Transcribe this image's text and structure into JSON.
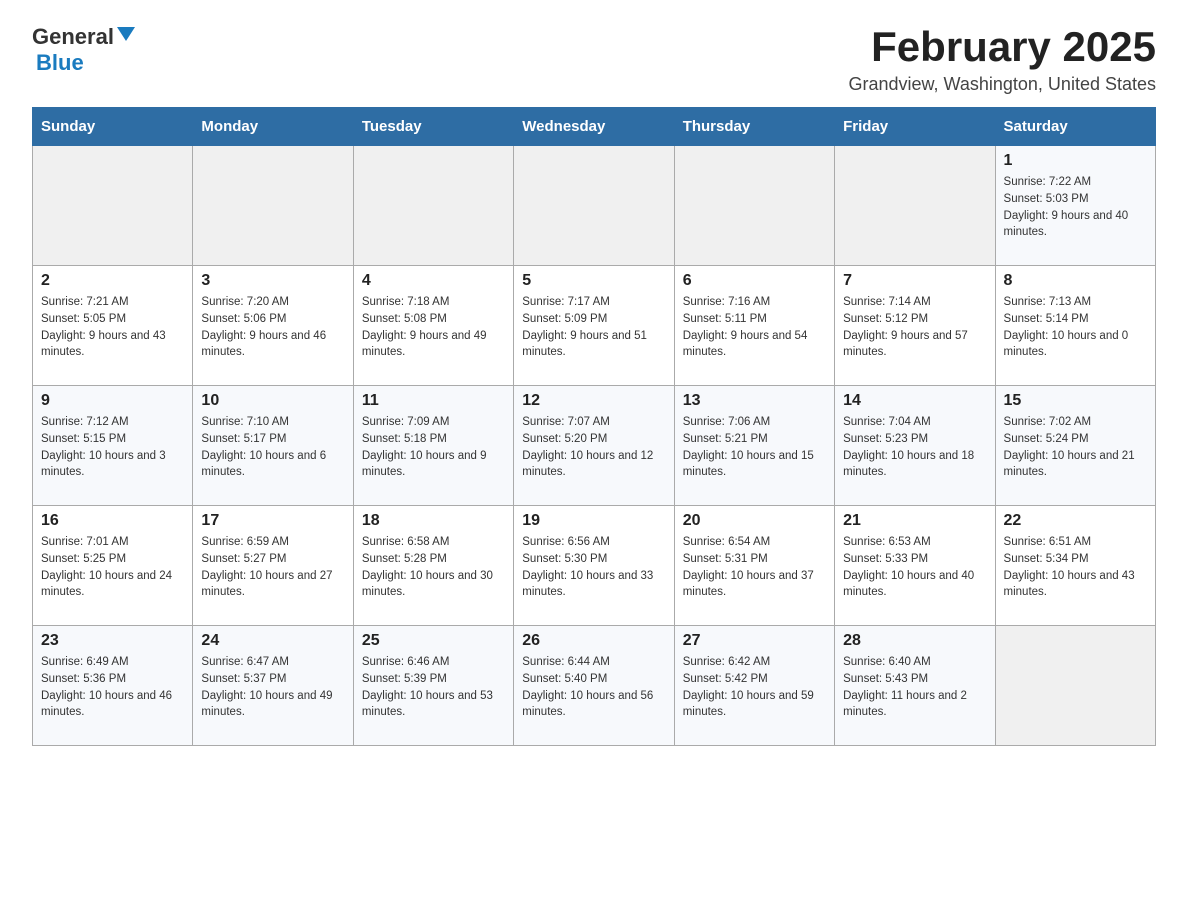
{
  "header": {
    "logo_general": "General",
    "logo_blue": "Blue",
    "month_title": "February 2025",
    "location": "Grandview, Washington, United States"
  },
  "weekdays": [
    "Sunday",
    "Monday",
    "Tuesday",
    "Wednesday",
    "Thursday",
    "Friday",
    "Saturday"
  ],
  "weeks": [
    [
      {
        "day": "",
        "info": ""
      },
      {
        "day": "",
        "info": ""
      },
      {
        "day": "",
        "info": ""
      },
      {
        "day": "",
        "info": ""
      },
      {
        "day": "",
        "info": ""
      },
      {
        "day": "",
        "info": ""
      },
      {
        "day": "1",
        "info": "Sunrise: 7:22 AM\nSunset: 5:03 PM\nDaylight: 9 hours and 40 minutes."
      }
    ],
    [
      {
        "day": "2",
        "info": "Sunrise: 7:21 AM\nSunset: 5:05 PM\nDaylight: 9 hours and 43 minutes."
      },
      {
        "day": "3",
        "info": "Sunrise: 7:20 AM\nSunset: 5:06 PM\nDaylight: 9 hours and 46 minutes."
      },
      {
        "day": "4",
        "info": "Sunrise: 7:18 AM\nSunset: 5:08 PM\nDaylight: 9 hours and 49 minutes."
      },
      {
        "day": "5",
        "info": "Sunrise: 7:17 AM\nSunset: 5:09 PM\nDaylight: 9 hours and 51 minutes."
      },
      {
        "day": "6",
        "info": "Sunrise: 7:16 AM\nSunset: 5:11 PM\nDaylight: 9 hours and 54 minutes."
      },
      {
        "day": "7",
        "info": "Sunrise: 7:14 AM\nSunset: 5:12 PM\nDaylight: 9 hours and 57 minutes."
      },
      {
        "day": "8",
        "info": "Sunrise: 7:13 AM\nSunset: 5:14 PM\nDaylight: 10 hours and 0 minutes."
      }
    ],
    [
      {
        "day": "9",
        "info": "Sunrise: 7:12 AM\nSunset: 5:15 PM\nDaylight: 10 hours and 3 minutes."
      },
      {
        "day": "10",
        "info": "Sunrise: 7:10 AM\nSunset: 5:17 PM\nDaylight: 10 hours and 6 minutes."
      },
      {
        "day": "11",
        "info": "Sunrise: 7:09 AM\nSunset: 5:18 PM\nDaylight: 10 hours and 9 minutes."
      },
      {
        "day": "12",
        "info": "Sunrise: 7:07 AM\nSunset: 5:20 PM\nDaylight: 10 hours and 12 minutes."
      },
      {
        "day": "13",
        "info": "Sunrise: 7:06 AM\nSunset: 5:21 PM\nDaylight: 10 hours and 15 minutes."
      },
      {
        "day": "14",
        "info": "Sunrise: 7:04 AM\nSunset: 5:23 PM\nDaylight: 10 hours and 18 minutes."
      },
      {
        "day": "15",
        "info": "Sunrise: 7:02 AM\nSunset: 5:24 PM\nDaylight: 10 hours and 21 minutes."
      }
    ],
    [
      {
        "day": "16",
        "info": "Sunrise: 7:01 AM\nSunset: 5:25 PM\nDaylight: 10 hours and 24 minutes."
      },
      {
        "day": "17",
        "info": "Sunrise: 6:59 AM\nSunset: 5:27 PM\nDaylight: 10 hours and 27 minutes."
      },
      {
        "day": "18",
        "info": "Sunrise: 6:58 AM\nSunset: 5:28 PM\nDaylight: 10 hours and 30 minutes."
      },
      {
        "day": "19",
        "info": "Sunrise: 6:56 AM\nSunset: 5:30 PM\nDaylight: 10 hours and 33 minutes."
      },
      {
        "day": "20",
        "info": "Sunrise: 6:54 AM\nSunset: 5:31 PM\nDaylight: 10 hours and 37 minutes."
      },
      {
        "day": "21",
        "info": "Sunrise: 6:53 AM\nSunset: 5:33 PM\nDaylight: 10 hours and 40 minutes."
      },
      {
        "day": "22",
        "info": "Sunrise: 6:51 AM\nSunset: 5:34 PM\nDaylight: 10 hours and 43 minutes."
      }
    ],
    [
      {
        "day": "23",
        "info": "Sunrise: 6:49 AM\nSunset: 5:36 PM\nDaylight: 10 hours and 46 minutes."
      },
      {
        "day": "24",
        "info": "Sunrise: 6:47 AM\nSunset: 5:37 PM\nDaylight: 10 hours and 49 minutes."
      },
      {
        "day": "25",
        "info": "Sunrise: 6:46 AM\nSunset: 5:39 PM\nDaylight: 10 hours and 53 minutes."
      },
      {
        "day": "26",
        "info": "Sunrise: 6:44 AM\nSunset: 5:40 PM\nDaylight: 10 hours and 56 minutes."
      },
      {
        "day": "27",
        "info": "Sunrise: 6:42 AM\nSunset: 5:42 PM\nDaylight: 10 hours and 59 minutes."
      },
      {
        "day": "28",
        "info": "Sunrise: 6:40 AM\nSunset: 5:43 PM\nDaylight: 11 hours and 2 minutes."
      },
      {
        "day": "",
        "info": ""
      }
    ]
  ]
}
